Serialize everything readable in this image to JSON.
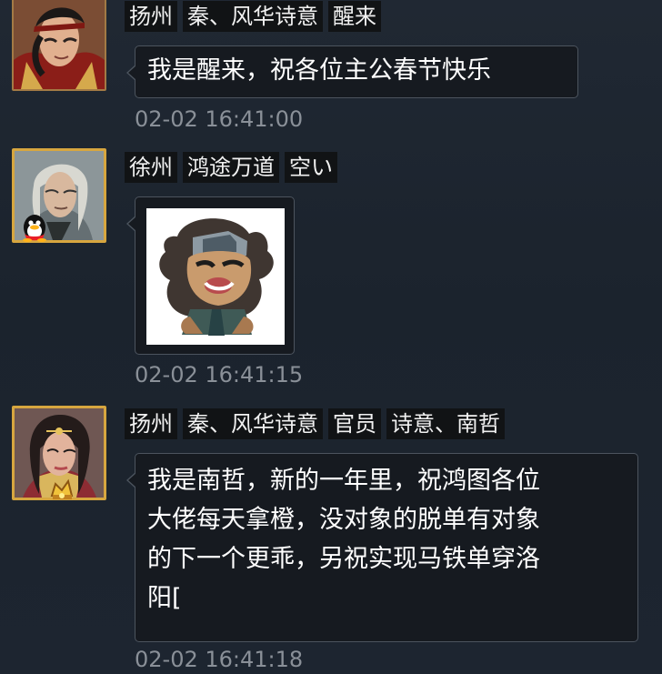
{
  "messages": [
    {
      "tags": [
        "扬州",
        "秦、风华诗意",
        "醒来"
      ],
      "text": "我是醒来，祝各位主公春节快乐",
      "time": "02-02 16:41:00",
      "avatar_icon": "male-warrior-avatar"
    },
    {
      "tags": [
        "徐州",
        "鸿途万道",
        "空い"
      ],
      "sticker_icon": "cartoon-warrior-sticker",
      "time": "02-02 16:41:15",
      "avatar_icon": "silver-hair-avatar",
      "badge_icon": "qq-penguin-icon"
    },
    {
      "tags": [
        "扬州",
        "秦、风华诗意",
        "官员",
        "诗意、南哲"
      ],
      "text": "我是南哲，新的一年里，祝鸿图各位\n大佬每天拿橙，没对象的脱单有对象\n的下一个更乖，另祝实现马铁单穿洛\n阳[",
      "time": "02-02 16:41:18",
      "avatar_icon": "female-general-avatar",
      "badge_icon": "gold-crown-badge-icon"
    }
  ],
  "colors": {
    "background": "#1d2530",
    "tag_background": "#111315",
    "bubble_background": "#161a20",
    "bubble_border": "#4c545e",
    "timestamp": "#8a9098",
    "gold_frame": "#d7a63f"
  }
}
